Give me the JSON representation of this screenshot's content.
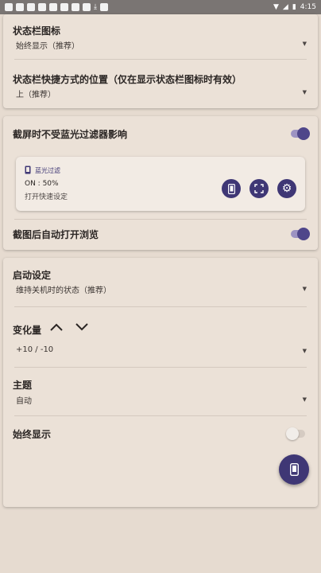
{
  "status_bar": {
    "time": "4:15"
  },
  "card1": {
    "status_icon": {
      "label": "状态栏图标",
      "value": "始终显示（推荐）"
    },
    "shortcut_position": {
      "label": "状态栏快捷方式的位置（仅在显示状态栏图标时有效）",
      "value": "上（推荐）"
    }
  },
  "card2": {
    "screenshot_filter": {
      "label": "截屏时不受蓝光过滤器影响",
      "on": true
    },
    "tile": {
      "title": "蓝光过滤",
      "status": "ON : 50%",
      "sub": "打开快速设定"
    },
    "auto_browse": {
      "label": "截图后自动打开浏览",
      "on": true
    }
  },
  "card3": {
    "startup": {
      "label": "启动设定",
      "value": "维持关机时的状态（推荐）"
    },
    "delta": {
      "label": "变化量",
      "value": "+10 / -10"
    },
    "theme": {
      "label": "主题",
      "value": "自动"
    },
    "always_show": {
      "label": "始终显示",
      "on": false
    }
  },
  "colors": {
    "accent": "#3f3775",
    "background": "#e6dbd0",
    "card": "#ebe1d7"
  }
}
